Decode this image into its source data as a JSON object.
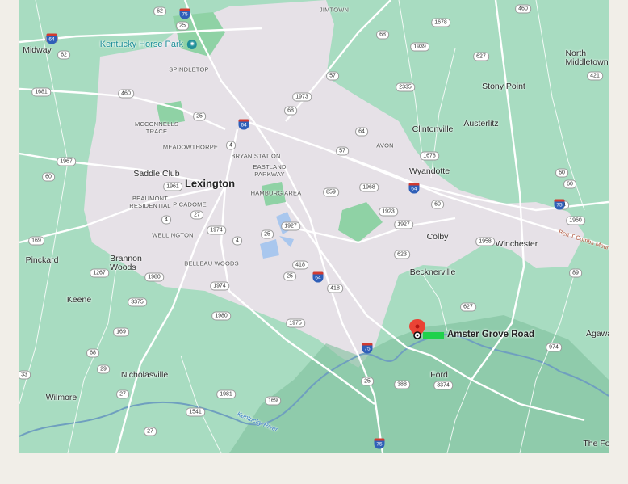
{
  "map": {
    "colors": {
      "land": "#a8dcc1",
      "urban": "#e6e1e7",
      "park": "#8fd2a5",
      "water": "#a9c7ee",
      "river": "#6f9fbf",
      "road": "#ffffff"
    },
    "places": [
      {
        "label": "Midway",
        "kind": "town"
      },
      {
        "label": "JIMTOWN",
        "kind": "hood"
      },
      {
        "label": "North Middletown",
        "kind": "town"
      },
      {
        "label": "SPINDLETOP",
        "kind": "hood"
      },
      {
        "label": "Stony Point",
        "kind": "town"
      },
      {
        "label": "MCCONNELLS TRACE",
        "kind": "hood"
      },
      {
        "label": "Clintonville",
        "kind": "town"
      },
      {
        "label": "Austerlitz",
        "kind": "town"
      },
      {
        "label": "MEADOWTHORPE",
        "kind": "hood"
      },
      {
        "label": "BRYAN STATION",
        "kind": "hood"
      },
      {
        "label": "AVON",
        "kind": "hood"
      },
      {
        "label": "Saddle Club",
        "kind": "town"
      },
      {
        "label": "EASTLAND PARKWAY",
        "kind": "hood"
      },
      {
        "label": "Wyandotte",
        "kind": "town"
      },
      {
        "label": "Lexington",
        "kind": "city"
      },
      {
        "label": "HAMBURG AREA",
        "kind": "hood"
      },
      {
        "label": "BEAUMONT RESIDENTIAL",
        "kind": "hood"
      },
      {
        "label": "PICADOME",
        "kind": "hood"
      },
      {
        "label": "WELLINGTON",
        "kind": "hood"
      },
      {
        "label": "Colby",
        "kind": "town"
      },
      {
        "label": "Winchester",
        "kind": "town"
      },
      {
        "label": "Pinckard",
        "kind": "town"
      },
      {
        "label": "Brannon Woods",
        "kind": "town"
      },
      {
        "label": "BELLEAU WOODS",
        "kind": "hood"
      },
      {
        "label": "Becknerville",
        "kind": "town"
      },
      {
        "label": "Keene",
        "kind": "town"
      },
      {
        "label": "Agawa",
        "kind": "town"
      },
      {
        "label": "Nicholasville",
        "kind": "town"
      },
      {
        "label": "Ford",
        "kind": "town"
      },
      {
        "label": "Wilmore",
        "kind": "town"
      },
      {
        "label": "The Fo",
        "kind": "town"
      }
    ],
    "poi": {
      "label": "Kentucky Horse Park"
    },
    "road_names": [
      "Bert T Combs Moun"
    ],
    "river_label": "Kentucky River",
    "destination": {
      "label": "Amster Grove Road",
      "pin_color": "#ea4335"
    },
    "route_shields": [
      "62",
      "25",
      "460",
      "68",
      "1678",
      "64",
      "1939",
      "62",
      "627",
      "1681",
      "2335",
      "57",
      "460",
      "421",
      "1973",
      "68",
      "25",
      "64",
      "4",
      "57",
      "1678",
      "1967",
      "60",
      "60",
      "1961",
      "1968",
      "859",
      "60",
      "60",
      "4",
      "27",
      "1923",
      "64",
      "1927",
      "1974",
      "1960",
      "4",
      "25",
      "169",
      "1958",
      "1927",
      "1267",
      "418",
      "623",
      "1980",
      "25",
      "1974",
      "418",
      "3375",
      "627",
      "89",
      "1980",
      "1975",
      "169",
      "68",
      "974",
      "29",
      "33",
      "27",
      "25",
      "1981",
      "169",
      "388",
      "1541",
      "3374",
      "27"
    ],
    "interstate_shields": [
      "75",
      "64",
      "64",
      "64",
      "75",
      "64",
      "75",
      "75"
    ]
  }
}
